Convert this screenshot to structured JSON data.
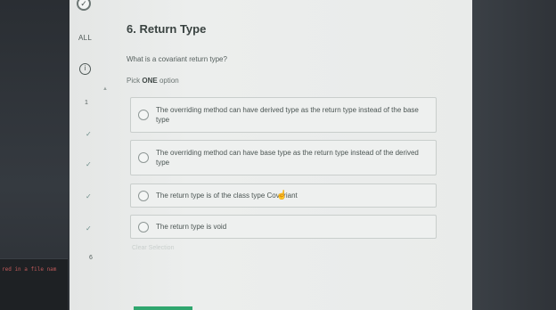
{
  "terminal": {
    "text": "red in a file nam"
  },
  "rail": {
    "all_label": "ALL",
    "info_icon": "info-icon",
    "numbers": [
      "1",
      "6"
    ],
    "check_icon": "✓"
  },
  "question": {
    "title": "6. Return Type",
    "prompt": "What is a covariant return type?",
    "pick_prefix": "Pick",
    "pick_emph": "ONE",
    "pick_suffix": "option",
    "options": [
      "The overriding method can have derived type as the return type instead of the base type",
      "The overriding method can have base type as the return type instead of the derived type",
      "The return type is of the class type Covariant",
      "The return type is void"
    ]
  },
  "footer": {
    "clear_label": "Clear Selection"
  },
  "colors": {
    "accent_green": "#2fa66e",
    "border": "#c9cecc"
  }
}
